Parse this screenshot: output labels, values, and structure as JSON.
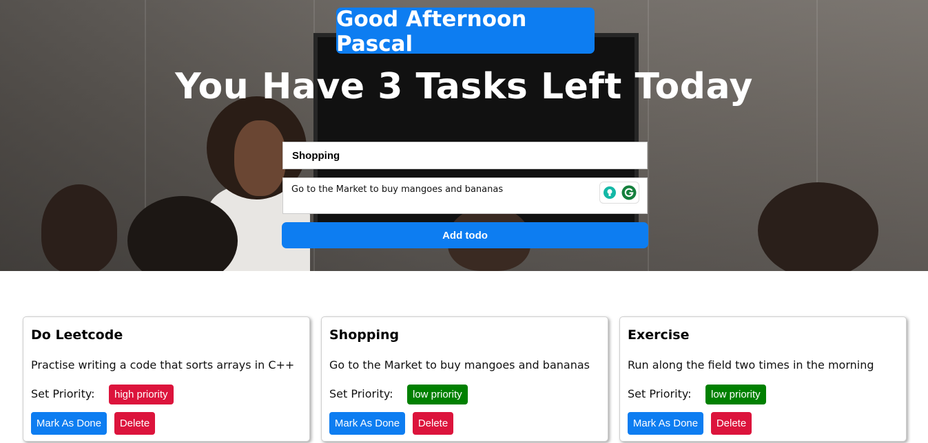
{
  "hero": {
    "greeting": "Good Afternoon Pascal",
    "headline": "You Have 3 Tasks Left Today"
  },
  "form": {
    "title_value": "Shopping",
    "description_value": "Go to the Market to buy mangoes and bananas",
    "add_label": "Add todo"
  },
  "colors": {
    "accent": "#0d7df1",
    "danger": "#dc143c",
    "high_priority": "#dc143c",
    "low_priority": "#008000"
  },
  "todos": [
    {
      "title": "Do Leetcode",
      "description": "Practise writing a code that sorts arrays in C++",
      "priority_label": "Set Priority:",
      "priority": "high priority",
      "done_label": "Mark As Done",
      "delete_label": "Delete"
    },
    {
      "title": "Shopping",
      "description": "Go to the Market to buy mangoes and bananas",
      "priority_label": "Set Priority:",
      "priority": "low priority",
      "done_label": "Mark As Done",
      "delete_label": "Delete"
    },
    {
      "title": "Exercise",
      "description": "Run along the field two times in the morning",
      "priority_label": "Set Priority:",
      "priority": "low priority",
      "done_label": "Mark As Done",
      "delete_label": "Delete"
    }
  ]
}
